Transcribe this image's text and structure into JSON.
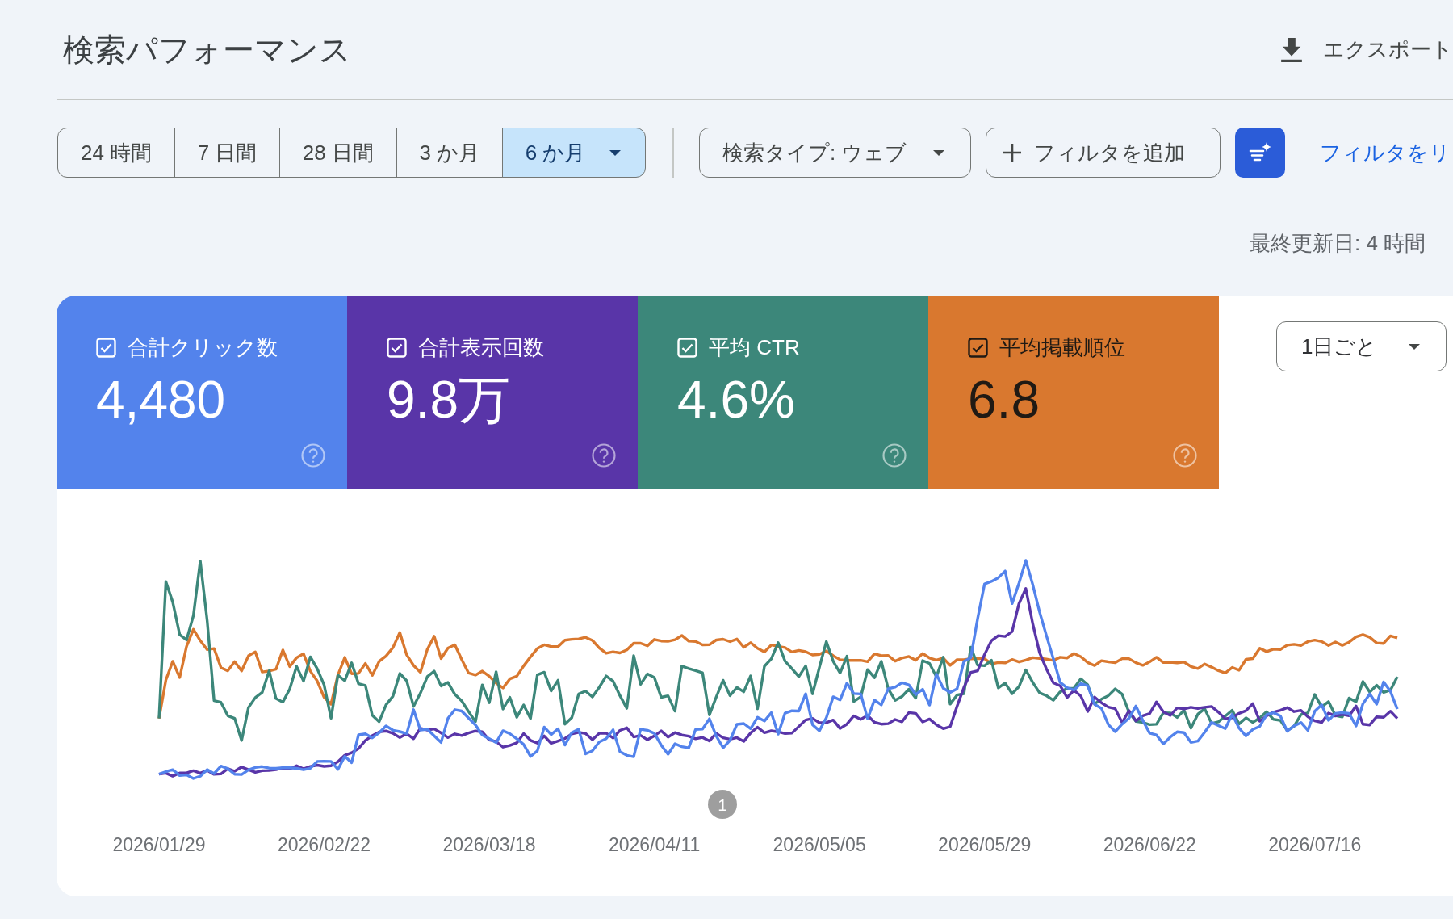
{
  "header": {
    "title": "検索パフォーマンス",
    "export_label": "エクスポート"
  },
  "toolbar": {
    "date_ranges": [
      {
        "label": "24 時間",
        "selected": false,
        "has_menu": false
      },
      {
        "label": "7 日間",
        "selected": false,
        "has_menu": false
      },
      {
        "label": "28 日間",
        "selected": false,
        "has_menu": false
      },
      {
        "label": "3 か月",
        "selected": false,
        "has_menu": false
      },
      {
        "label": "6 か月",
        "selected": true,
        "has_menu": true
      }
    ],
    "search_type": "検索タイプ: ウェブ",
    "add_filter": "フィルタを追加",
    "reset_link": "フィルタをリ"
  },
  "last_updated": "最終更新日: 4 時間",
  "metrics": [
    {
      "label": "合計クリック数",
      "value": "4,480",
      "checked": true,
      "color": "#5383ec"
    },
    {
      "label": "合計表示回数",
      "value": "9.8万",
      "checked": true,
      "color": "#5935a8"
    },
    {
      "label": "平均 CTR",
      "value": "4.6%",
      "checked": true,
      "color": "#3c877a"
    },
    {
      "label": "平均掲載順位",
      "value": "6.8",
      "checked": true,
      "color": "#d9782f"
    }
  ],
  "granularity": {
    "value": "1日ごと"
  },
  "chart": {
    "x_labels": [
      "2026/01/29",
      "2026/02/22",
      "2026/03/18",
      "2026/04/11",
      "2026/05/05",
      "2026/05/29",
      "2026/06/22",
      "2026/07/16"
    ],
    "annotations": [
      {
        "label": "1"
      }
    ]
  }
}
